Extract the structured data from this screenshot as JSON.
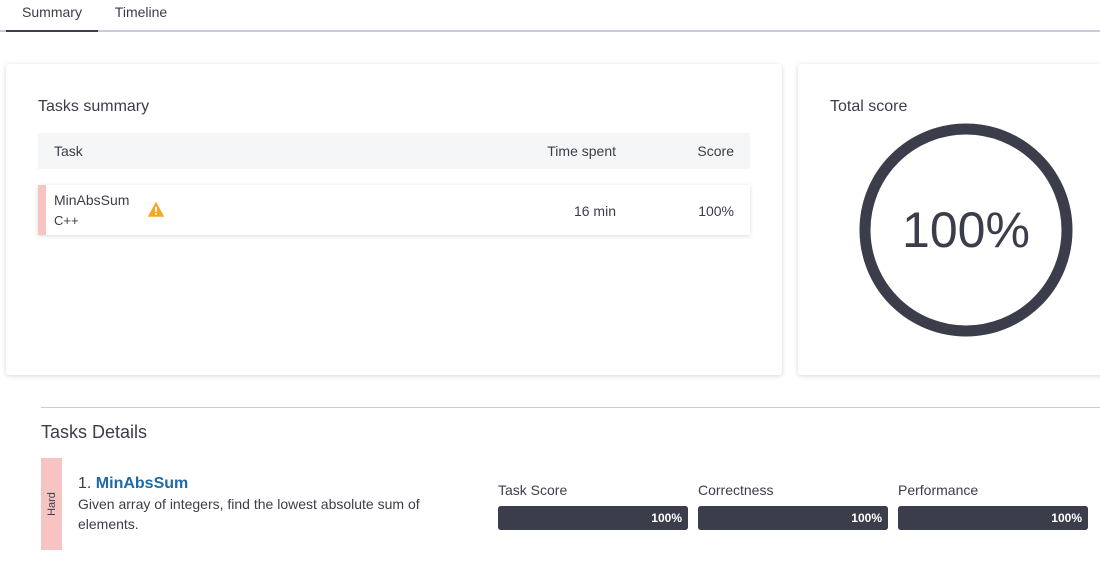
{
  "tabs": [
    {
      "label": "Summary",
      "active": true
    },
    {
      "label": "Timeline",
      "active": false
    }
  ],
  "tasks_summary": {
    "title": "Tasks summary",
    "headers": {
      "task": "Task",
      "time": "Time spent",
      "score": "Score"
    },
    "rows": [
      {
        "name": "MinAbsSum",
        "language": "C++",
        "warning_icon": "warning-icon",
        "time": "16 min",
        "score": "100%"
      }
    ]
  },
  "total_score": {
    "title": "Total score",
    "value": "100%",
    "fraction": 1.0
  },
  "task_details": {
    "title": "Tasks Details",
    "tasks": [
      {
        "difficulty": "Hard",
        "number": "1.",
        "name": "MinAbsSum",
        "description": "Given array of integers, find the lowest absolute sum of elements.",
        "metrics": [
          {
            "label": "Task Score",
            "value": "100%",
            "fraction": 1.0
          },
          {
            "label": "Correctness",
            "value": "100%",
            "fraction": 1.0
          },
          {
            "label": "Performance",
            "value": "100%",
            "fraction": 1.0
          }
        ]
      }
    ]
  },
  "colors": {
    "text": "#3b3e4a",
    "accent_dark": "#3b3e4a",
    "hard_badge": "#f7c3c3",
    "link": "#1e6aa8",
    "warning": "#f5a623"
  }
}
